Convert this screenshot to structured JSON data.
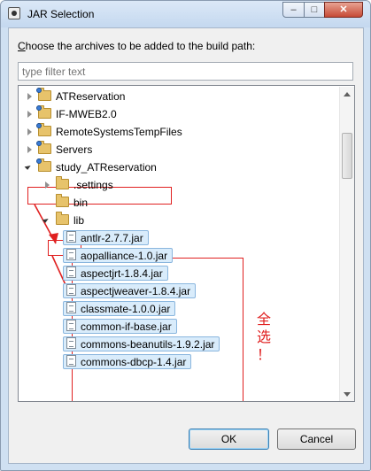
{
  "window": {
    "title": "JAR Selection",
    "min_glyph": "–",
    "max_glyph": "□",
    "close_glyph": "✕"
  },
  "prompt": {
    "mnemonic": "C",
    "rest": "hoose the archives to be added to the build path:"
  },
  "filter": {
    "placeholder": "type filter text",
    "value": ""
  },
  "tree": {
    "items": [
      {
        "label": "ATReservation",
        "kind": "project",
        "level": 0,
        "state": "collapsed"
      },
      {
        "label": "IF-MWEB2.0",
        "kind": "project",
        "level": 0,
        "state": "collapsed"
      },
      {
        "label": "RemoteSystemsTempFiles",
        "kind": "project",
        "level": 0,
        "state": "collapsed"
      },
      {
        "label": "Servers",
        "kind": "project",
        "level": 0,
        "state": "collapsed"
      },
      {
        "label": "study_ATReservation",
        "kind": "project",
        "level": 0,
        "state": "expanded"
      },
      {
        "label": ".settings",
        "kind": "folder",
        "level": 1,
        "state": "collapsed"
      },
      {
        "label": "bin",
        "kind": "folder",
        "level": 1,
        "state": "leaf"
      },
      {
        "label": "lib",
        "kind": "folder",
        "level": 1,
        "state": "expanded"
      },
      {
        "label": "antlr-2.7.7.jar",
        "kind": "jar",
        "level": 2,
        "selected": true
      },
      {
        "label": "aopalliance-1.0.jar",
        "kind": "jar",
        "level": 2,
        "selected": true
      },
      {
        "label": "aspectjrt-1.8.4.jar",
        "kind": "jar",
        "level": 2,
        "selected": true
      },
      {
        "label": "aspectjweaver-1.8.4.jar",
        "kind": "jar",
        "level": 2,
        "selected": true
      },
      {
        "label": "classmate-1.0.0.jar",
        "kind": "jar",
        "level": 2,
        "selected": true
      },
      {
        "label": "common-if-base.jar",
        "kind": "jar",
        "level": 2,
        "selected": true
      },
      {
        "label": "commons-beanutils-1.9.2.jar",
        "kind": "jar",
        "level": 2,
        "selected": true
      },
      {
        "label": "commons-dbcp-1.4.jar",
        "kind": "jar",
        "level": 2,
        "selected": true
      }
    ]
  },
  "annotation": {
    "text": "全\n选\n！",
    "color": "#e02020"
  },
  "buttons": {
    "ok": "OK",
    "cancel": "Cancel"
  }
}
